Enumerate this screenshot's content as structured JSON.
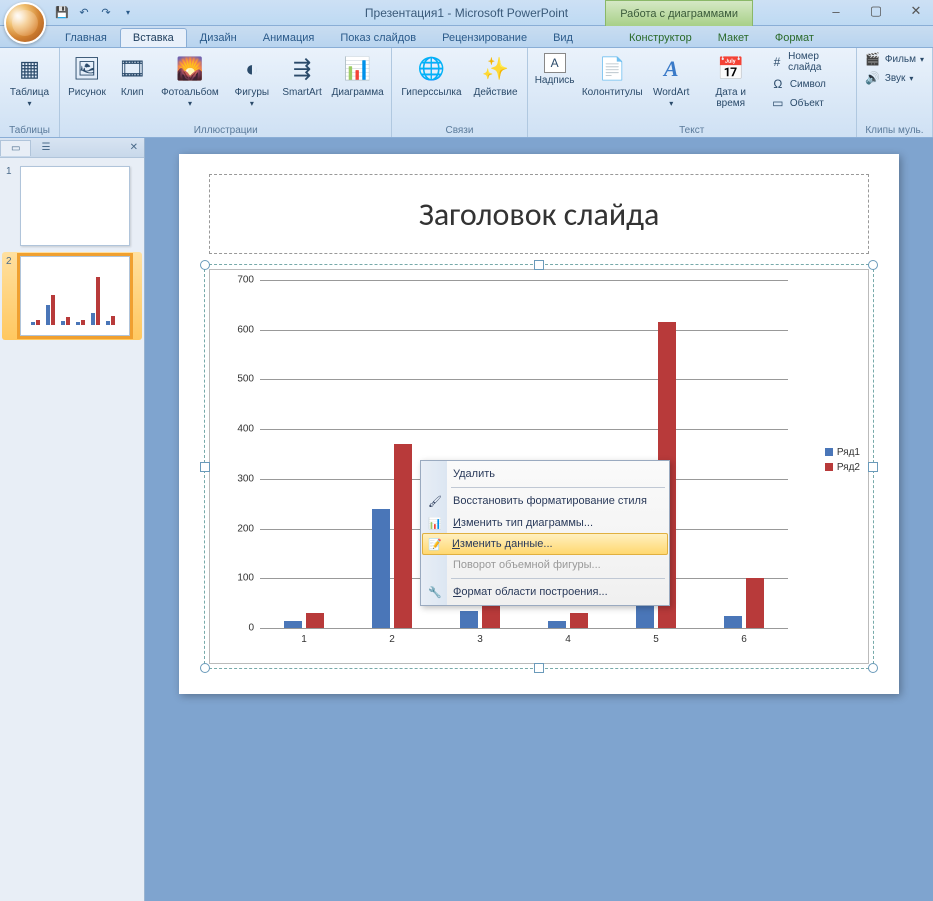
{
  "title": "Презентация1 - Microsoft PowerPoint",
  "chart_tools_label": "Работа с диаграммами",
  "qat": {
    "save": "💾",
    "undo": "↶",
    "redo": "↷"
  },
  "tabs": [
    "Главная",
    "Вставка",
    "Дизайн",
    "Анимация",
    "Показ слайдов",
    "Рецензирование",
    "Вид"
  ],
  "tabs_chart": [
    "Конструктор",
    "Макет",
    "Формат"
  ],
  "active_tab": "Вставка",
  "ribbon": {
    "g_tables": {
      "label": "Таблицы",
      "table": "Таблица"
    },
    "g_illustr": {
      "label": "Иллюстрации",
      "pic": "Рисунок",
      "clip": "Клип",
      "album": "Фотоальбом",
      "shapes": "Фигуры",
      "smartart": "SmartArt",
      "chart": "Диаграмма"
    },
    "g_links": {
      "label": "Связи",
      "hyper": "Гиперссылка",
      "action": "Действие"
    },
    "g_text": {
      "label": "Текст",
      "textbox": "Надпись",
      "headfoot": "Колонтитулы",
      "wordart": "WordArt",
      "date": "Дата и время",
      "slidenum": "Номер слайда",
      "symbol": "Символ",
      "object": "Объект"
    },
    "g_media": {
      "label": "Клипы муль.",
      "film": "Фильм",
      "sound": "Звук"
    }
  },
  "thumbs": {
    "tab_outline": "",
    "slides": [
      "1",
      "2"
    ]
  },
  "slide": {
    "title": "Заголовок слайда"
  },
  "legend": {
    "s1": "Ряд1",
    "s2": "Ряд2"
  },
  "context_menu": {
    "delete": "Удалить",
    "restore": "Восстановить форматирование стиля",
    "change_type": "Изменить тип диаграммы...",
    "edit_data": "Изменить данные...",
    "rotate3d": "Поворот объемной фигуры...",
    "format_plot": "Формат области построения..."
  },
  "chart_data": {
    "type": "bar",
    "categories": [
      "1",
      "2",
      "3",
      "4",
      "5",
      "6"
    ],
    "series": [
      {
        "name": "Ряд1",
        "values": [
          15,
          240,
          35,
          15,
          125,
          25
        ],
        "color": "#4a76b8"
      },
      {
        "name": "Ряд2",
        "values": [
          30,
          370,
          90,
          30,
          615,
          100
        ],
        "color": "#b83a3a"
      }
    ],
    "ylim": [
      0,
      700
    ],
    "yticks": [
      0,
      100,
      200,
      300,
      400,
      500,
      600,
      700
    ],
    "title": "",
    "xlabel": "",
    "ylabel": ""
  }
}
